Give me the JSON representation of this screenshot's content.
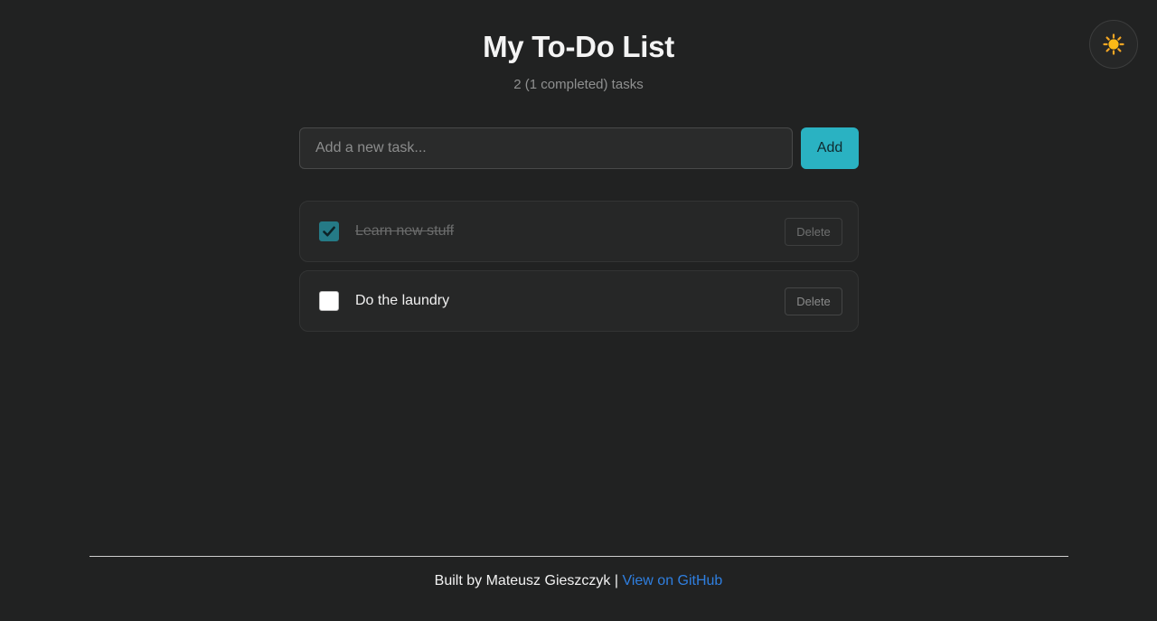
{
  "header": {
    "title": "My To-Do List",
    "subtitle": "2 (1 completed) tasks"
  },
  "theme_toggle": {
    "icon": "sun-icon"
  },
  "new_task": {
    "placeholder": "Add a new task...",
    "value": "",
    "add_label": "Add"
  },
  "tasks": [
    {
      "text": "Learn new stuff",
      "completed": true,
      "delete_label": "Delete"
    },
    {
      "text": "Do the laundry",
      "completed": false,
      "delete_label": "Delete"
    }
  ],
  "footer": {
    "built_by": "Built by Mateusz Gieszczyk |",
    "link_label": "View on GitHub"
  },
  "colors": {
    "background": "#212222",
    "accent": "#2ab2c2",
    "checked": "#257a86",
    "link": "#2f7fe0"
  }
}
